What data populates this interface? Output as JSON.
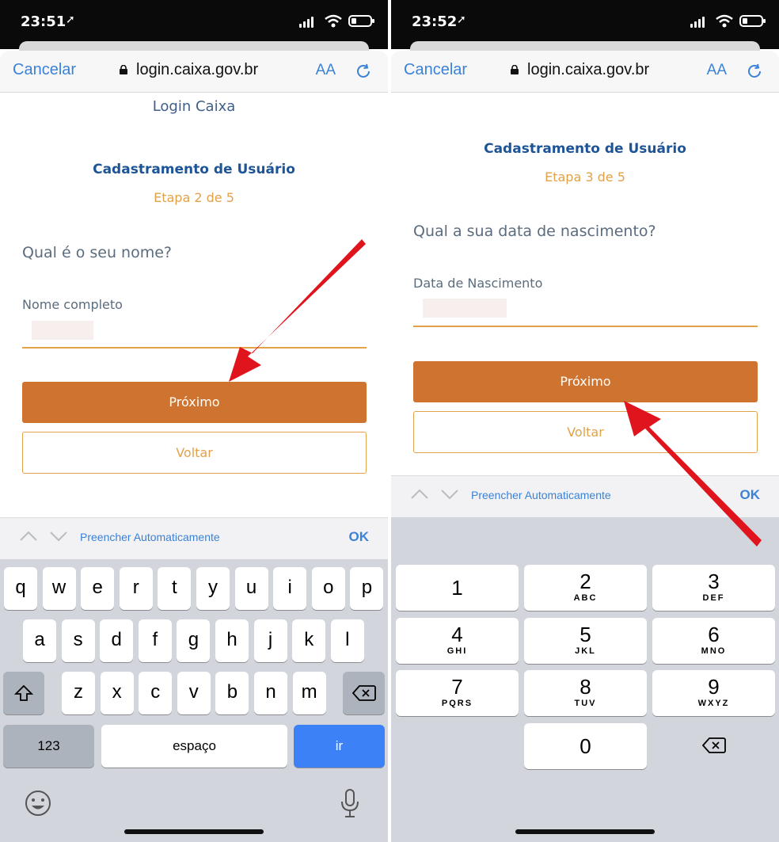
{
  "colors": {
    "accent": "#3b82d6",
    "primary_button": "#cf7430",
    "step": "#e2a24a",
    "title": "#1d5496",
    "arrow": "#e0141c"
  },
  "left": {
    "status": {
      "time": "23:51"
    },
    "browser": {
      "cancel": "Cancelar",
      "url": "login.caixa.gov.br",
      "text_size": "AA"
    },
    "page": {
      "header": "Login Caixa",
      "title": "Cadastramento de Usuário",
      "step": "Etapa 2 de 5",
      "question": "Qual é o seu nome?",
      "field_label": "Nome completo",
      "next": "Próximo",
      "back": "Voltar"
    },
    "autofill": {
      "label": "Preencher Automaticamente",
      "ok": "OK"
    },
    "keyboard": {
      "row1": [
        "q",
        "w",
        "e",
        "r",
        "t",
        "y",
        "u",
        "i",
        "o",
        "p"
      ],
      "row2": [
        "a",
        "s",
        "d",
        "f",
        "g",
        "h",
        "j",
        "k",
        "l"
      ],
      "row3": [
        "z",
        "x",
        "c",
        "v",
        "b",
        "n",
        "m"
      ],
      "numbers": "123",
      "space": "espaço",
      "go": "ir",
      "icons": [
        "shift-icon",
        "delete-icon",
        "emoji-icon",
        "microphone-icon"
      ]
    }
  },
  "right": {
    "status": {
      "time": "23:52"
    },
    "browser": {
      "cancel": "Cancelar",
      "url": "login.caixa.gov.br",
      "text_size": "AA"
    },
    "page": {
      "title": "Cadastramento de Usuário",
      "step": "Etapa 3 de 5",
      "question": "Qual a sua data de nascimento?",
      "field_label": "Data de Nascimento",
      "next": "Próximo",
      "back": "Voltar"
    },
    "autofill": {
      "label": "Preencher Automaticamente",
      "ok": "OK"
    },
    "keypad": [
      {
        "n": "1",
        "l": ""
      },
      {
        "n": "2",
        "l": "ABC"
      },
      {
        "n": "3",
        "l": "DEF"
      },
      {
        "n": "4",
        "l": "GHI"
      },
      {
        "n": "5",
        "l": "JKL"
      },
      {
        "n": "6",
        "l": "MNO"
      },
      {
        "n": "7",
        "l": "PQRS"
      },
      {
        "n": "8",
        "l": "TUV"
      },
      {
        "n": "9",
        "l": "WXYZ"
      },
      {
        "n": "0",
        "l": ""
      }
    ]
  }
}
